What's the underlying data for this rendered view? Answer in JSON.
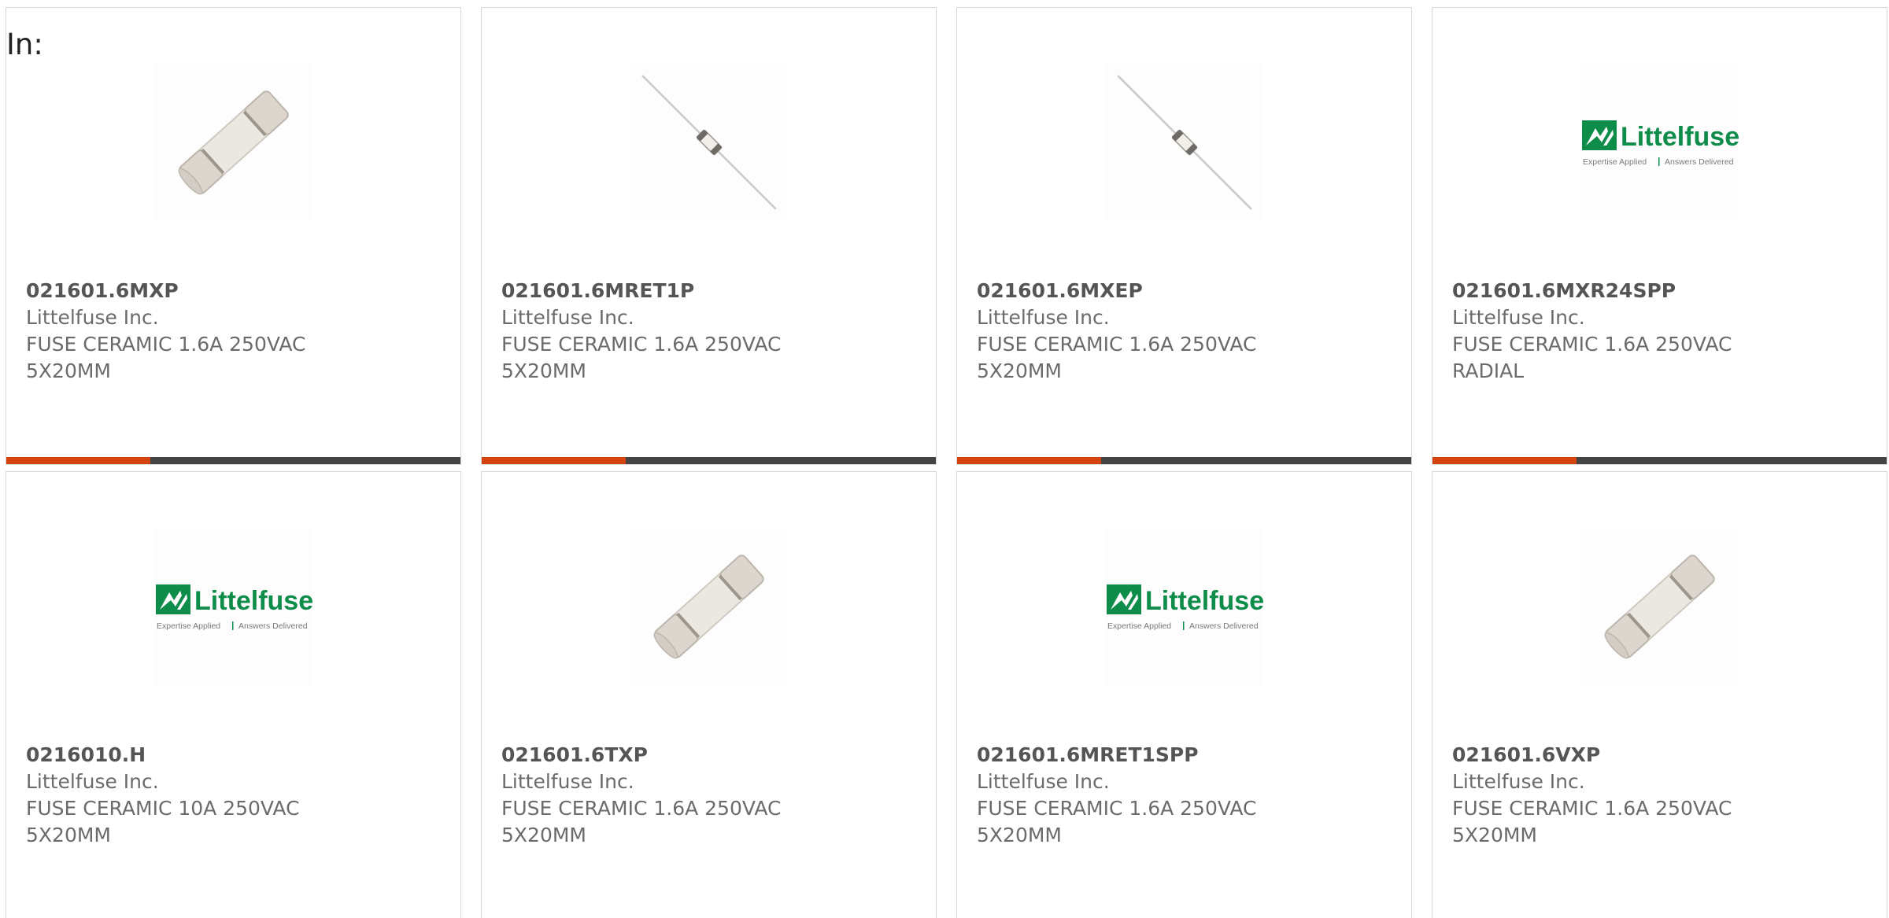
{
  "header": {
    "label": "In:"
  },
  "colors": {
    "accent": "#d4420f",
    "bar_dark": "#444444",
    "brand_green": "#0e8c4a",
    "part_number": "#555555",
    "text": "#6b6b6b"
  },
  "products": [
    {
      "part_number": "021601.6MXP",
      "manufacturer": "Littelfuse Inc.",
      "description": "FUSE CERAMIC 1.6A 250VAC 5X20MM",
      "image": "cartridge-fuse-image"
    },
    {
      "part_number": "021601.6MRET1P",
      "manufacturer": "Littelfuse Inc.",
      "description": "FUSE CERAMIC 1.6A 250VAC 5X20MM",
      "image": "axial-fuse-image"
    },
    {
      "part_number": "021601.6MXEP",
      "manufacturer": "Littelfuse Inc.",
      "description": "FUSE CERAMIC 1.6A 250VAC 5X20MM",
      "image": "axial-fuse-image"
    },
    {
      "part_number": "021601.6MXR24SPP",
      "manufacturer": "Littelfuse Inc.",
      "description": "FUSE CERAMIC 1.6A 250VAC RADIAL",
      "image": "littelfuse-logo"
    },
    {
      "part_number": "0216010.H",
      "manufacturer": "Littelfuse Inc.",
      "description": "FUSE CERAMIC 10A 250VAC 5X20MM",
      "image": "littelfuse-logo"
    },
    {
      "part_number": "021601.6TXP",
      "manufacturer": "Littelfuse Inc.",
      "description": "FUSE CERAMIC 1.6A 250VAC 5X20MM",
      "image": "cartridge-fuse-image"
    },
    {
      "part_number": "021601.6MRET1SPP",
      "manufacturer": "Littelfuse Inc.",
      "description": "FUSE CERAMIC 1.6A 250VAC 5X20MM",
      "image": "littelfuse-logo"
    },
    {
      "part_number": "021601.6VXP",
      "manufacturer": "Littelfuse Inc.",
      "description": "FUSE CERAMIC 1.6A 250VAC 5X20MM",
      "image": "cartridge-fuse-image"
    }
  ],
  "logo": {
    "brand": "Littelfuse",
    "tagline_left": "Expertise Applied",
    "tagline_right": "Answers Delivered"
  }
}
